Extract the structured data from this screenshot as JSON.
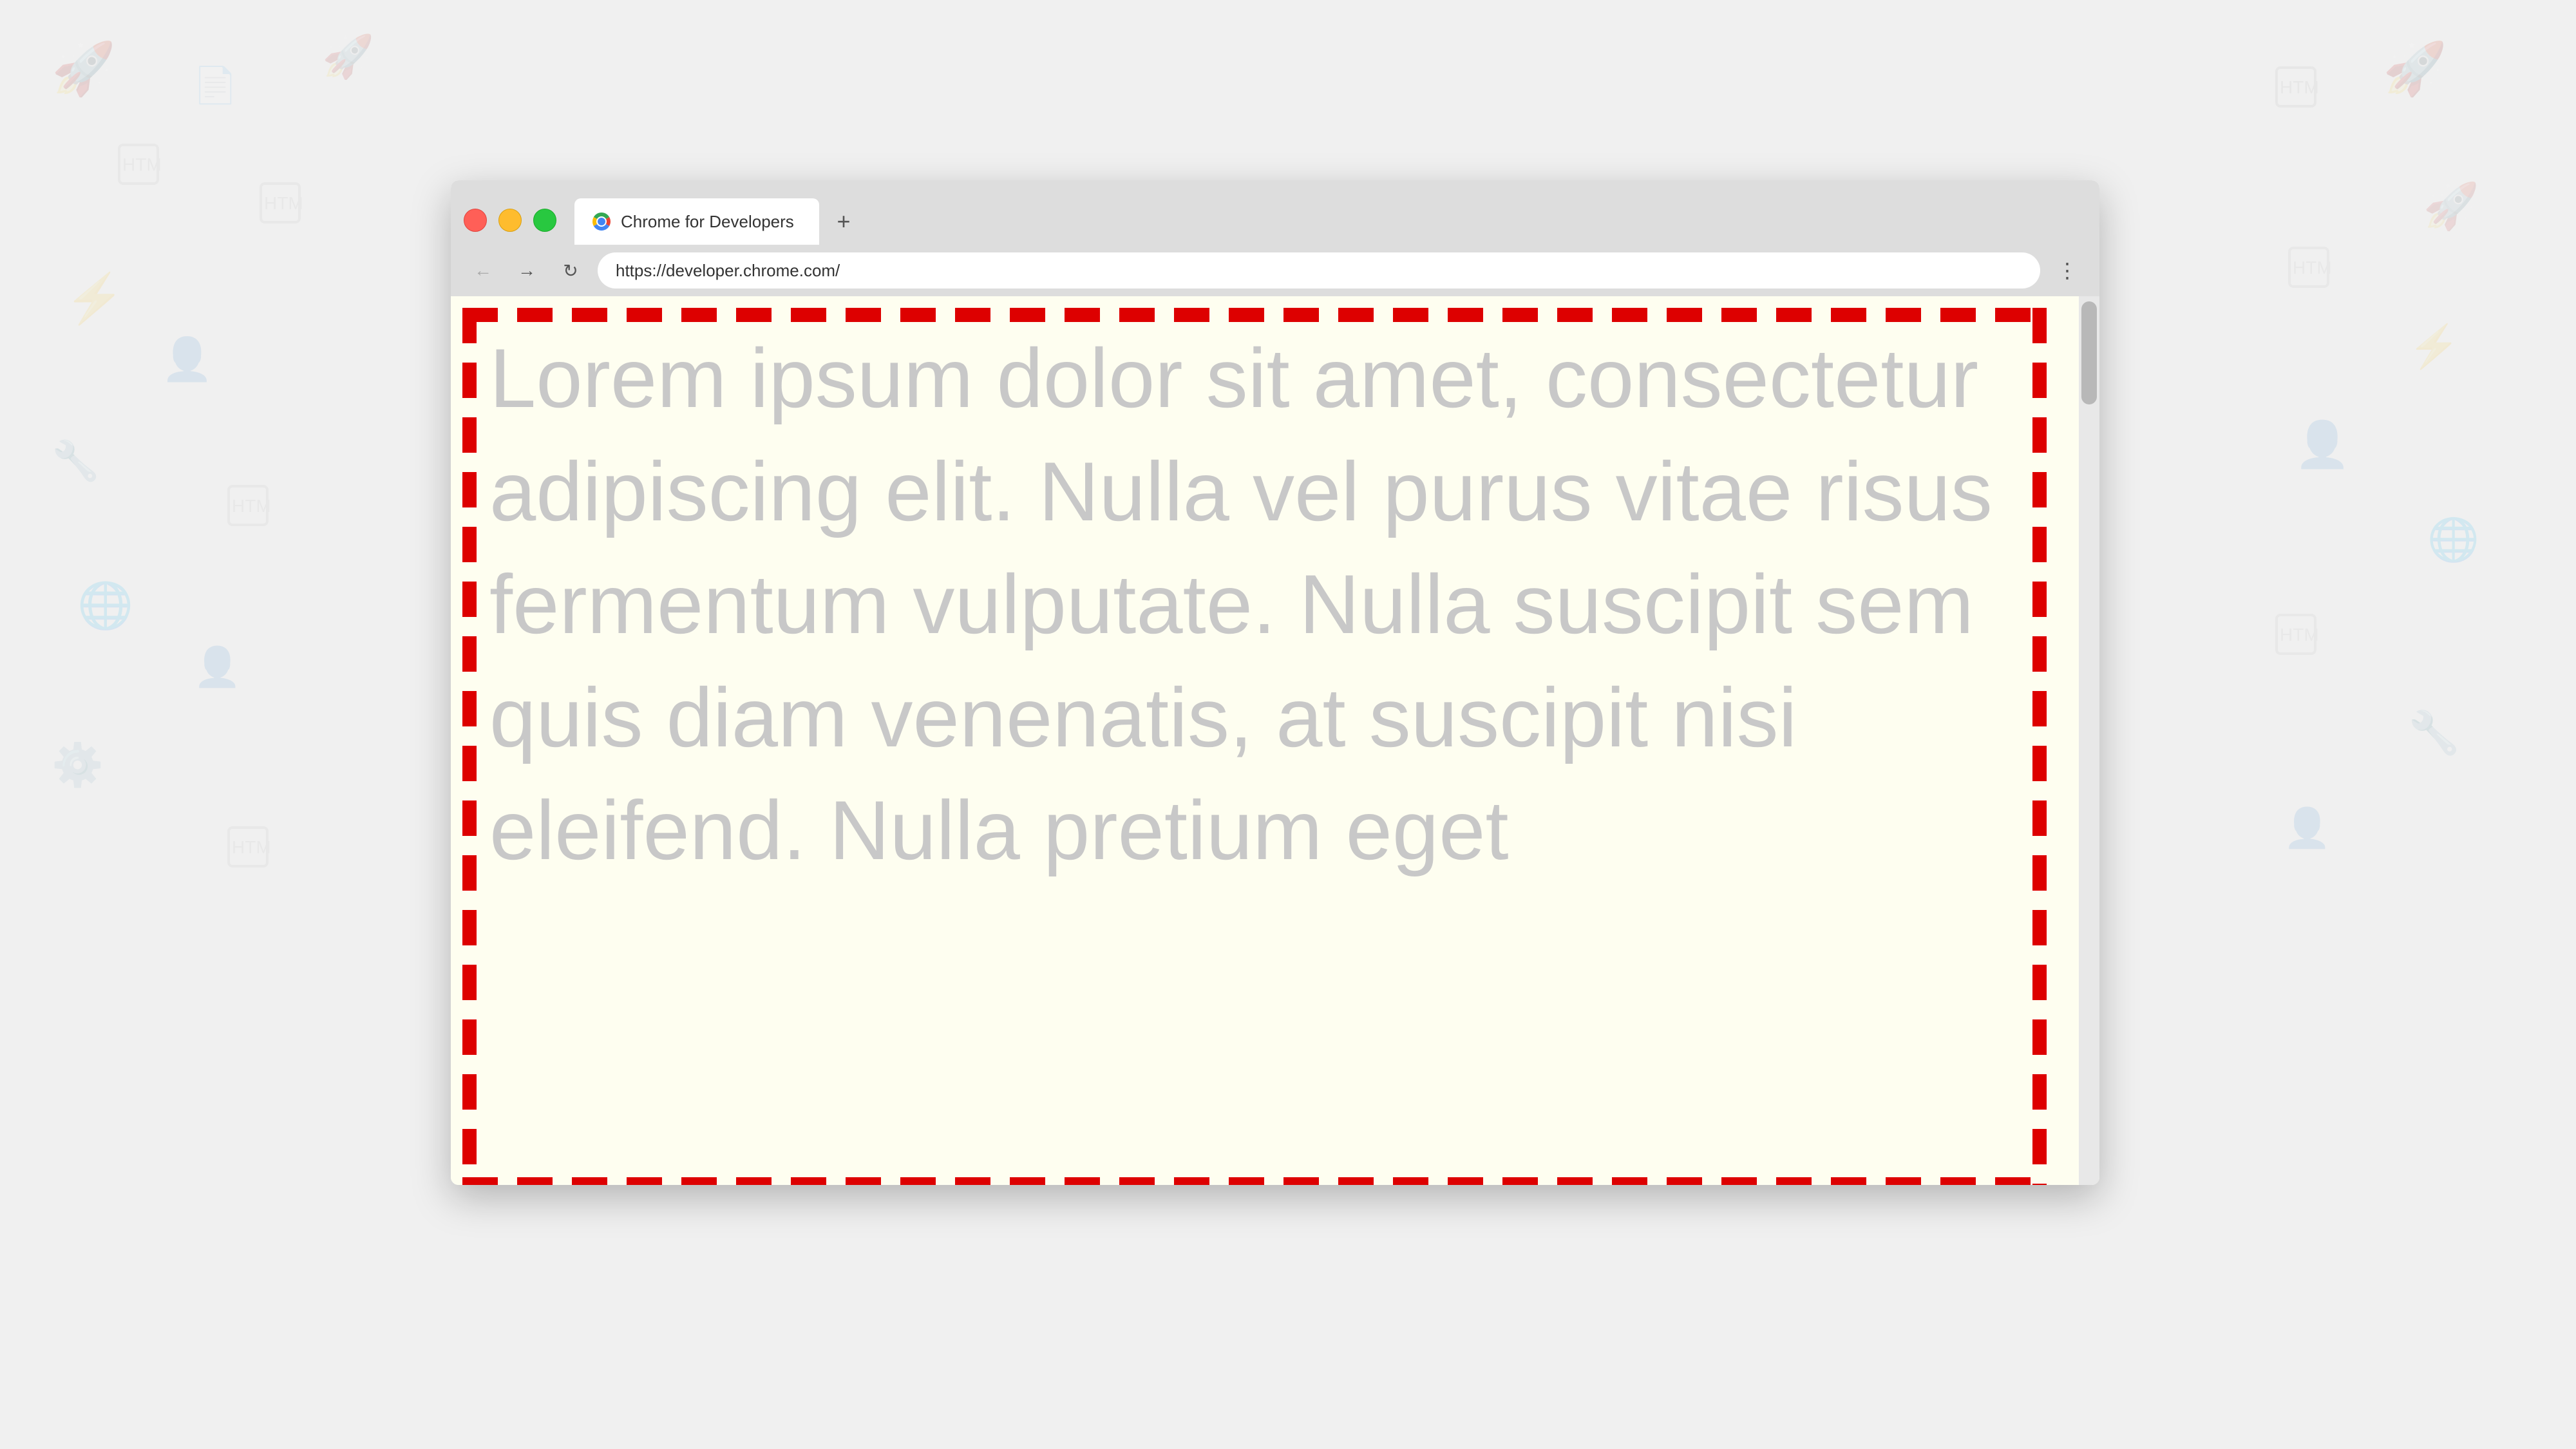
{
  "background": {
    "color": "#f0f0f0"
  },
  "browser": {
    "tab": {
      "title": "Chrome for Developers",
      "favicon": "chrome"
    },
    "new_tab_label": "+",
    "address": "https://developer.chrome.com/",
    "nav": {
      "back_label": "←",
      "forward_label": "→",
      "reload_label": "↻",
      "menu_label": "⋮"
    },
    "content": {
      "text": "Lorem ipsum dolor sit amet, consectetur adipiscing elit. Nulla vel purus vitae risus fermentum vulputate. Nulla suscipit sem quis diam venenatis, at suscipit nisi eleifend. Nulla pretium eget"
    },
    "scrollbar": {
      "visible": true
    }
  }
}
